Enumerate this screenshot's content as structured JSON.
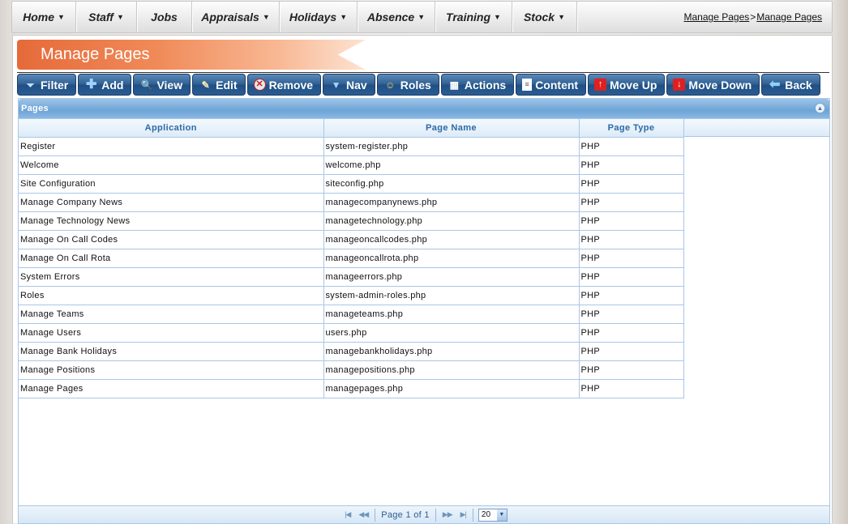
{
  "nav": {
    "items": [
      {
        "label": "Home",
        "dropdown": true
      },
      {
        "label": "Staff",
        "dropdown": true
      },
      {
        "label": "Jobs",
        "dropdown": false
      },
      {
        "label": "Appraisals",
        "dropdown": true
      },
      {
        "label": "Holidays",
        "dropdown": true
      },
      {
        "label": "Absence",
        "dropdown": true
      },
      {
        "label": "Training",
        "dropdown": true
      },
      {
        "label": "Stock",
        "dropdown": true
      }
    ],
    "caret": "▼"
  },
  "breadcrumb": {
    "first": "Manage Pages",
    "separator": ">",
    "second": "Manage Pages"
  },
  "page_title": "Manage Pages",
  "toolbar": {
    "buttons": [
      {
        "label": "Filter",
        "icon": "filter-icon",
        "glyph": "⏷"
      },
      {
        "label": "Add",
        "icon": "plus-icon",
        "glyph": "✚"
      },
      {
        "label": "View",
        "icon": "magnifier-icon",
        "glyph": "🔍"
      },
      {
        "label": "Edit",
        "icon": "pencil-icon",
        "glyph": "✎"
      },
      {
        "label": "Remove",
        "icon": "remove-icon",
        "glyph": "✕"
      },
      {
        "label": "Nav",
        "icon": "nav-arrow-icon",
        "glyph": "▼"
      },
      {
        "label": "Roles",
        "icon": "user-icon",
        "glyph": "☺"
      },
      {
        "label": "Actions",
        "icon": "clapperboard-icon",
        "glyph": "▦"
      },
      {
        "label": "Content",
        "icon": "document-icon",
        "glyph": "≡"
      },
      {
        "label": "Move Up",
        "icon": "arrow-up-icon",
        "glyph": "↑"
      },
      {
        "label": "Move Down",
        "icon": "arrow-down-icon",
        "glyph": "↓"
      },
      {
        "label": "Back",
        "icon": "arrow-left-icon",
        "glyph": "⬅"
      }
    ]
  },
  "grid": {
    "title": "Pages",
    "collapse_glyph": "▲",
    "columns": [
      "Application",
      "Page Name",
      "Page Type"
    ],
    "rows": [
      [
        "Register",
        "system-register.php",
        "PHP"
      ],
      [
        "Welcome",
        "welcome.php",
        "PHP"
      ],
      [
        "Site Configuration",
        "siteconfig.php",
        "PHP"
      ],
      [
        "Manage Company News",
        "managecompanynews.php",
        "PHP"
      ],
      [
        "Manage Technology News",
        "managetechnology.php",
        "PHP"
      ],
      [
        "Manage On Call Codes",
        "manageoncallcodes.php",
        "PHP"
      ],
      [
        "Manage On Call Rota",
        "manageoncallrota.php",
        "PHP"
      ],
      [
        "System Errors",
        "manageerrors.php",
        "PHP"
      ],
      [
        "Roles",
        "system-admin-roles.php",
        "PHP"
      ],
      [
        "Manage Teams",
        "manageteams.php",
        "PHP"
      ],
      [
        "Manage Users",
        "users.php",
        "PHP"
      ],
      [
        "Manage Bank Holidays",
        "managebankholidays.php",
        "PHP"
      ],
      [
        "Manage Positions",
        "managepositions.php",
        "PHP"
      ],
      [
        "Manage Pages",
        "managepages.php",
        "PHP"
      ]
    ]
  },
  "pager": {
    "first": "|◀",
    "prev": "◀◀",
    "status": "Page 1 of 1",
    "next": "▶▶",
    "last": "▶|",
    "page_size": "20"
  },
  "colors": {
    "button_bg": "#2e5f92",
    "title_ribbon": "#e66a3a",
    "grid_header": "#6ea3d6",
    "column_text": "#2d6aa5"
  }
}
